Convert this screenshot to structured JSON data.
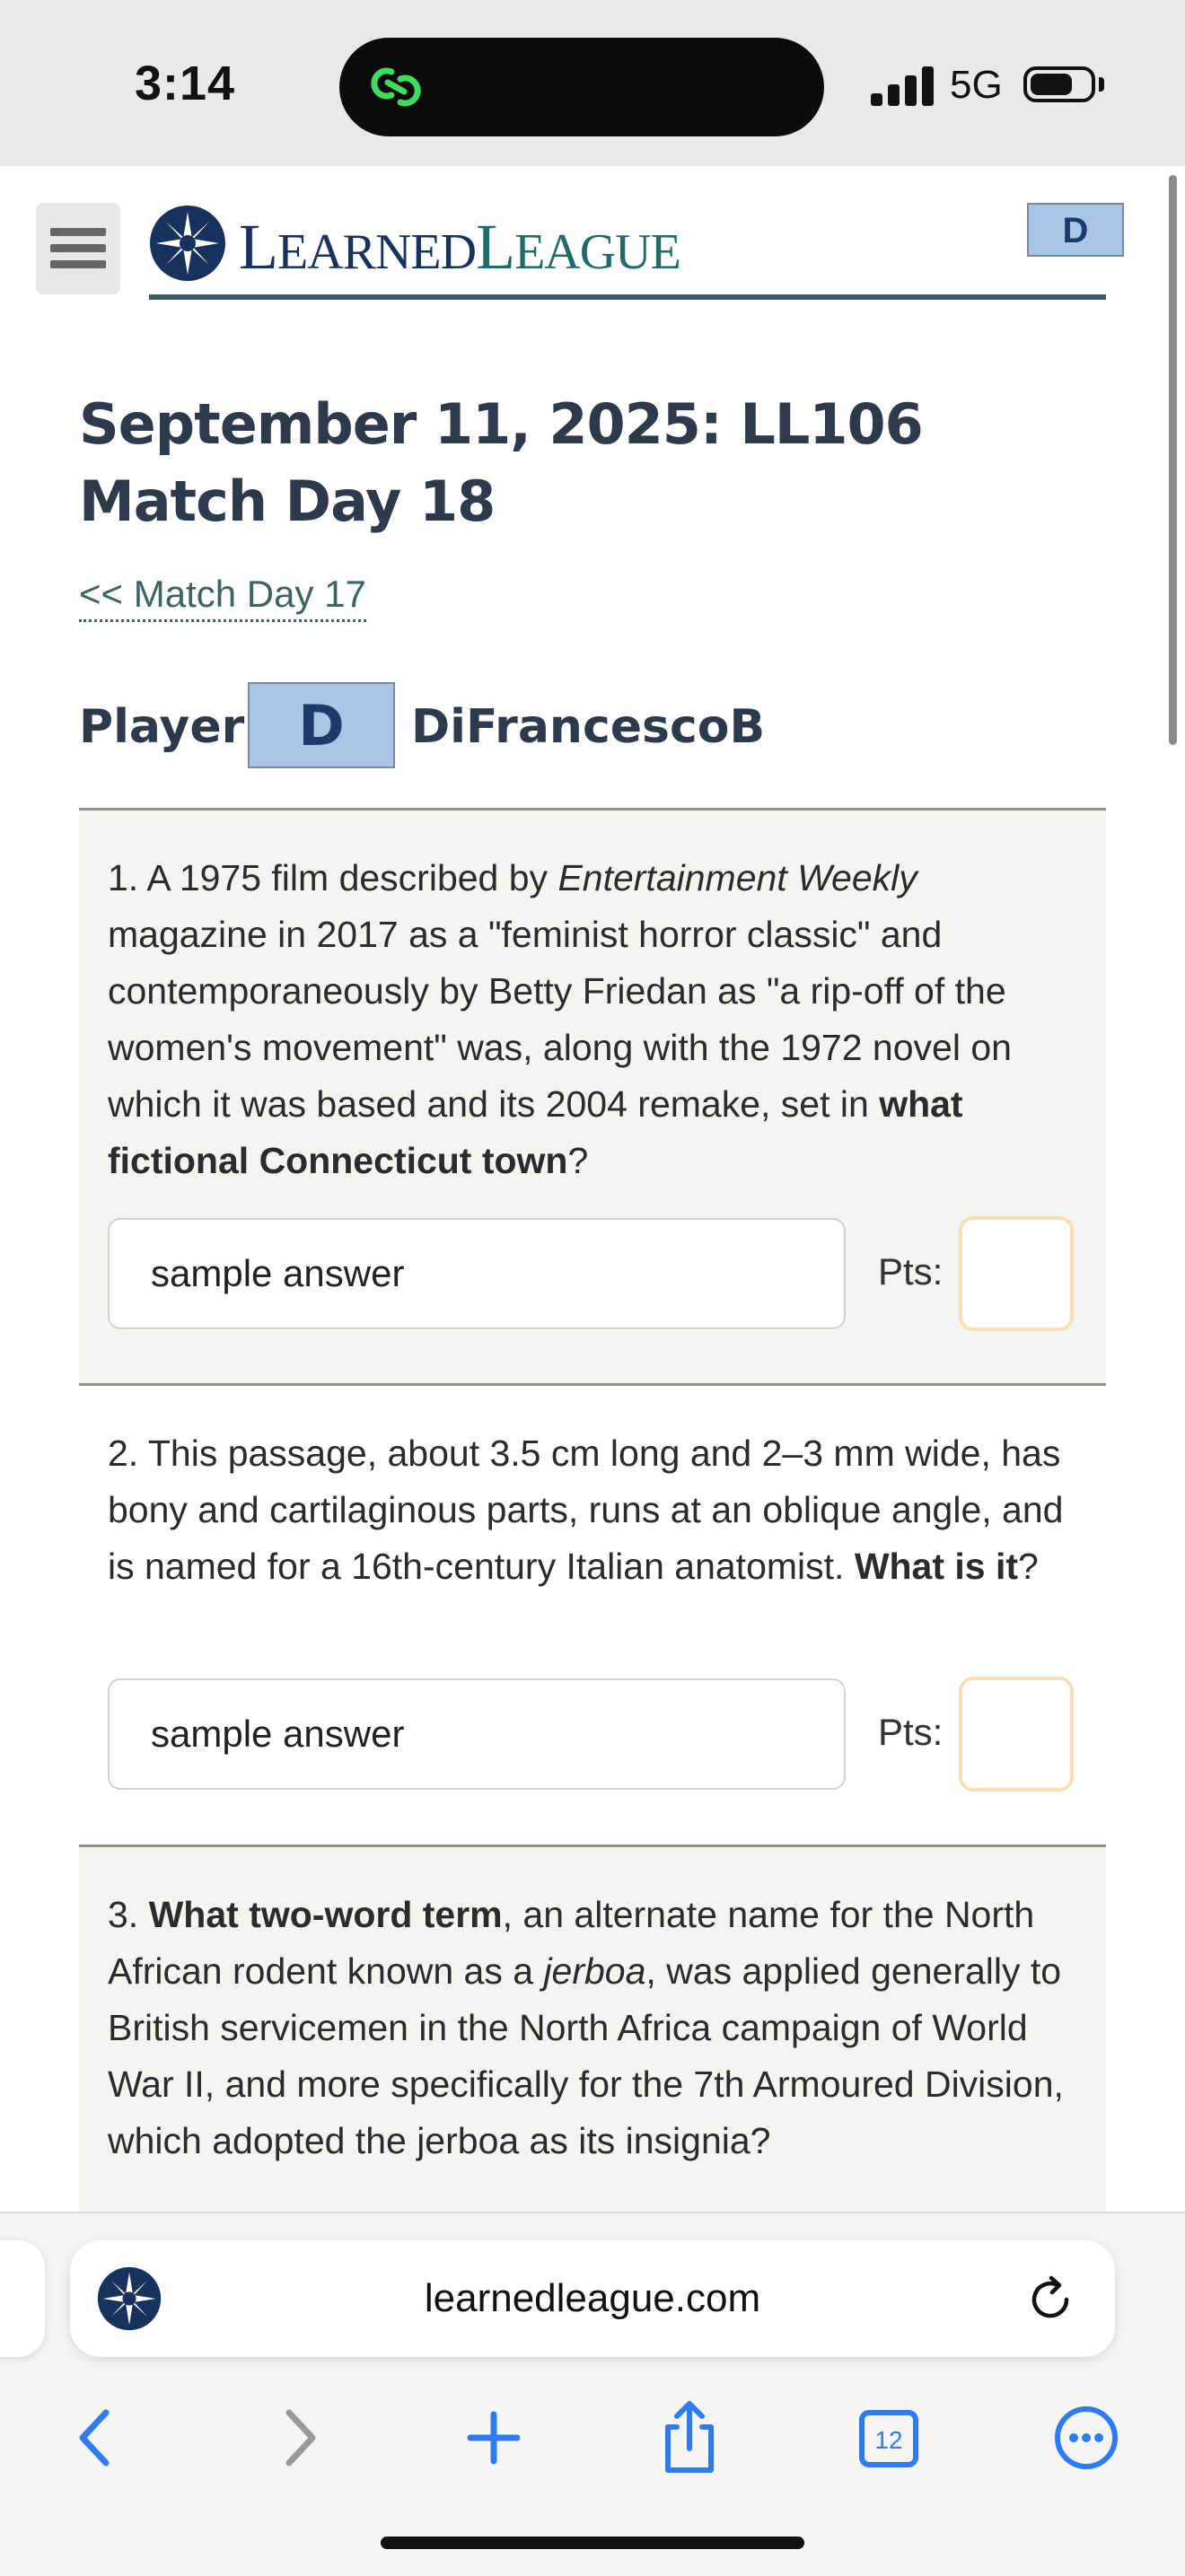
{
  "status_bar": {
    "time": "3:14",
    "network": "5G"
  },
  "header": {
    "logo_first": "L",
    "logo_first_rest": "EARNED",
    "logo_second": "L",
    "logo_second_rest": "EAGUE",
    "level_badge": "D"
  },
  "page": {
    "title": "September 11, 2025: LL106 Match Day 18",
    "prev_link": "<< Match Day 17",
    "player_label": "Player:",
    "player_level": "D",
    "player_name": "DiFrancescoB"
  },
  "questions": [
    {
      "number": "1.",
      "text_parts": [
        "A 1975 film described by ",
        "Entertainment Weekly",
        " magazine in 2017 as a \"feminist horror classic\" and contemporaneously by Betty Friedan as \"a rip-off of the women's movement\" was, along with the 1972 novel on which it was based and its 2004 remake, set in ",
        "what fictional Connecticut town",
        "?"
      ],
      "answer": "sample answer",
      "pts_label": "Pts:"
    },
    {
      "number": "2.",
      "text_parts": [
        "This passage, about 3.5 cm long and 2–3 mm wide, has bony and cartilaginous parts, runs at an oblique angle, and is named for a 16th-century Italian anatomist. ",
        "What is it",
        "?"
      ],
      "answer": "sample answer",
      "pts_label": "Pts:"
    },
    {
      "number": "3.",
      "text_parts": [
        "What two-word term",
        ", an alternate name for the North African rodent known as a ",
        "jerboa",
        ", was applied generally to British servicemen in the North Africa campaign of World War II, and more specifically for the 7th Armoured Division, which adopted the jerboa as its insignia?"
      ]
    }
  ],
  "browser": {
    "url": "learnedleague.com",
    "tab_count": "12"
  },
  "colors": {
    "accent_teal": "#3d6465",
    "badge_blue": "#a9c6e8",
    "navy": "#17325c",
    "ios_blue": "#2f7bf6"
  }
}
